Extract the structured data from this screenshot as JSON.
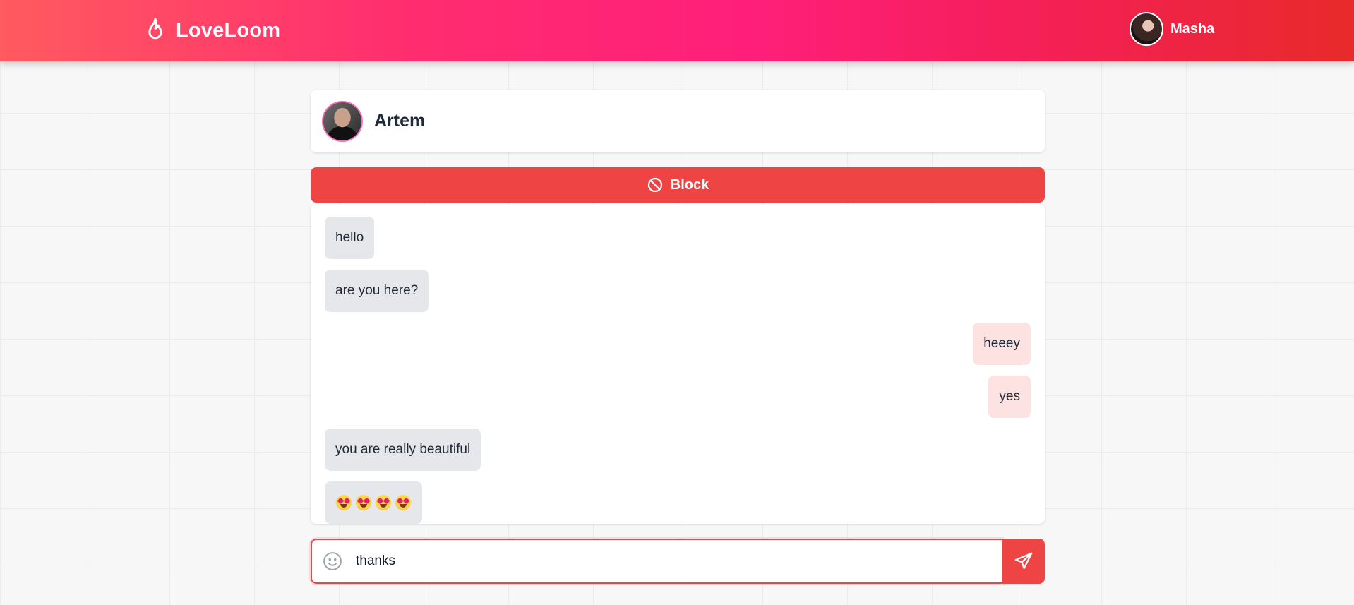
{
  "app": {
    "name": "LoveLoom",
    "logo_icon": "flame-icon"
  },
  "user": {
    "name": "Masha",
    "avatar_icon": "user-avatar"
  },
  "contact": {
    "name": "Artem"
  },
  "actions": {
    "block_label": "Block",
    "block_icon": "ban-icon"
  },
  "messages": [
    {
      "direction": "in",
      "text": "hello"
    },
    {
      "direction": "in",
      "text": "are you here?"
    },
    {
      "direction": "out",
      "text": "heeey"
    },
    {
      "direction": "out",
      "text": "yes"
    },
    {
      "direction": "in",
      "text": "you are really beautiful"
    },
    {
      "direction": "in",
      "text": "😍😍😍😍",
      "emoji": "smiling-face-with-heart-eyes",
      "emoji_count": 4
    }
  ],
  "composer": {
    "value": "thanks",
    "emoji_icon": "smile-icon",
    "send_icon": "send-icon"
  },
  "colors": {
    "accent": "#ef4444",
    "header_gradient": [
      "#ff5a5f",
      "#ff1f7a",
      "#e82a2a"
    ],
    "incoming_bubble": "#e5e7eb",
    "outgoing_bubble": "#fde2e2"
  }
}
